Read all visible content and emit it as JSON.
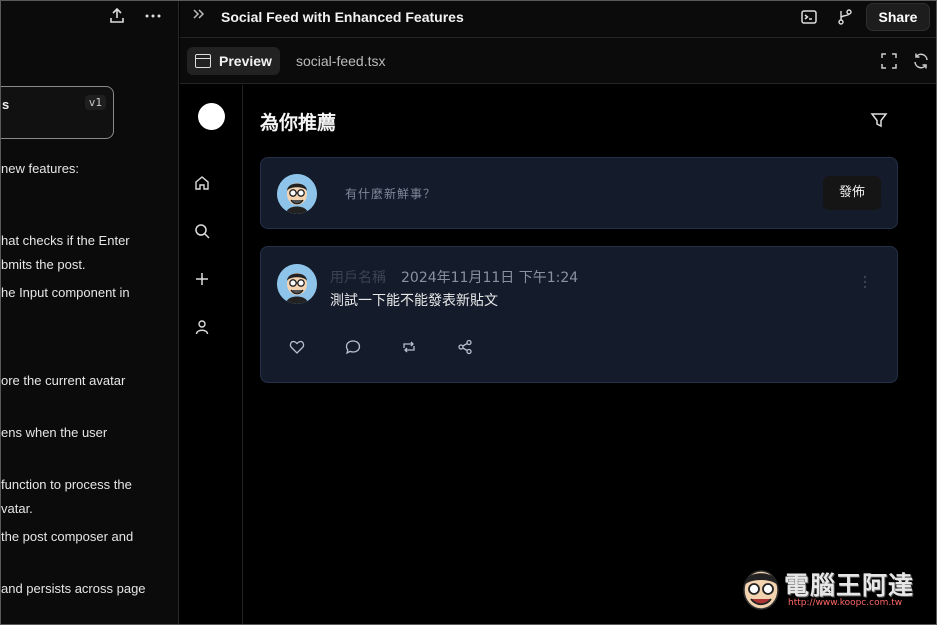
{
  "chat": {
    "version_card": {
      "title": "s",
      "version": "v1"
    },
    "lines": [
      "new features:",
      "hat checks if the Enter",
      "bmits the post.",
      "he Input component in",
      "ore the current avatar",
      "ens when the user",
      "function to process the",
      "vatar.",
      "the post composer and",
      "and persists across page"
    ]
  },
  "header": {
    "title": "Social Feed with Enhanced Features",
    "share_label": "Share"
  },
  "tabs": {
    "preview_label": "Preview",
    "file_label": "social-feed.tsx"
  },
  "feed": {
    "title": "為你推薦",
    "composer": {
      "placeholder": "有什麼新鮮事？",
      "post_button": "發佈"
    },
    "posts": [
      {
        "username": "用戶名稱",
        "timestamp": "2024年11月11日 下午1:24",
        "content": "測試一下能不能發表新貼文"
      }
    ]
  },
  "watermark": {
    "text": "電腦王阿達",
    "url": "http://www.koopc.com.tw"
  },
  "colors": {
    "card_bg": "#141b2b",
    "card_border": "#243049",
    "avatar_bg": "#8ec4ea"
  }
}
